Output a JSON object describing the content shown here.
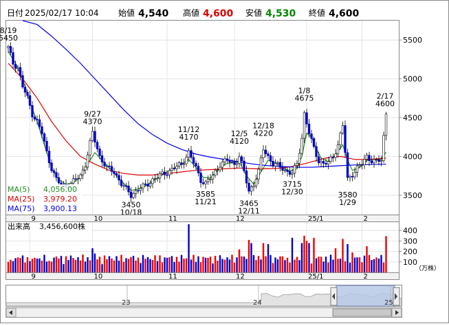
{
  "header": {
    "date_label": "日付",
    "date_value": "2025/02/17 10:04",
    "open_label": "始値",
    "open_value": "4,540",
    "high_label": "高値",
    "high_value": "4,600",
    "low_label": "安値",
    "low_value": "4,530",
    "close_label": "終値",
    "close_value": "4,600"
  },
  "colors": {
    "up": "#ffffff",
    "down": "#0000cc",
    "ma5": "#228b22",
    "ma25": "#dd0000",
    "ma75": "#0000ee",
    "vol_up": "#ee0000",
    "vol_down": "#0000cc",
    "high_text": "#e00000",
    "low_text": "#008800"
  },
  "legend": {
    "ma5": "MA(5)",
    "ma5_value": "4,056.00",
    "ma25": "MA(25)",
    "ma25_value": "3,979.20",
    "ma75": "MA(75)",
    "ma75_value": "3,900.13"
  },
  "volume_panel": {
    "label": "出来高",
    "value": "3,456,600株",
    "unit": "（万株）"
  },
  "navigator": {
    "year_labels": [
      "23",
      "24",
      "25"
    ]
  },
  "chart_data": [
    {
      "type": "candlestick",
      "ylim": [
        3250,
        5750
      ],
      "yticks": [
        3500,
        4000,
        4500,
        5000,
        5500
      ],
      "x_tick_labels": [
        {
          "label": "9",
          "day": 9
        },
        {
          "label": "10",
          "day": 35
        },
        {
          "label": "11",
          "day": 66
        },
        {
          "label": "12",
          "day": 94
        },
        {
          "label": "25/1",
          "day": 124
        },
        {
          "label": "2",
          "day": 147
        }
      ],
      "annotations": [
        {
          "text": [
            "8/19",
            "5450"
          ],
          "day": 0,
          "value": 5450,
          "pos": "above"
        },
        {
          "text": [
            "9/27",
            "4370"
          ],
          "day": 35,
          "value": 4370,
          "pos": "above"
        },
        {
          "text": [
            "3450",
            "10/18"
          ],
          "day": 51,
          "value": 3450,
          "pos": "below"
        },
        {
          "text": [
            "11/12",
            "4170"
          ],
          "day": 75,
          "value": 4170,
          "pos": "above"
        },
        {
          "text": [
            "3585",
            "11/21"
          ],
          "day": 82,
          "value": 3585,
          "pos": "below"
        },
        {
          "text": [
            "12/5",
            "4120"
          ],
          "day": 96,
          "value": 4120,
          "pos": "above"
        },
        {
          "text": [
            "3465",
            "12/11"
          ],
          "day": 100,
          "value": 3465,
          "pos": "below"
        },
        {
          "text": [
            "12/18",
            "4220"
          ],
          "day": 106,
          "value": 4220,
          "pos": "above"
        },
        {
          "text": [
            "3715",
            "12/30"
          ],
          "day": 118,
          "value": 3715,
          "pos": "below"
        },
        {
          "text": [
            "1/8",
            "4675"
          ],
          "day": 123,
          "value": 4675,
          "pos": "above"
        },
        {
          "text": [
            "3580",
            "1/29"
          ],
          "day": 141,
          "value": 3580,
          "pos": "below"
        },
        {
          "text": [
            "2/17",
            "4600"
          ],
          "day": 157,
          "value": 4600,
          "pos": "above"
        }
      ],
      "keypoints": [
        [
          0,
          5400
        ],
        [
          2,
          5200
        ],
        [
          4,
          5150
        ],
        [
          6,
          4900
        ],
        [
          8,
          4750
        ],
        [
          10,
          4550
        ],
        [
          12,
          4450
        ],
        [
          14,
          4300
        ],
        [
          16,
          4050
        ],
        [
          18,
          3850
        ],
        [
          20,
          3700
        ],
        [
          22,
          3630
        ],
        [
          24,
          3610
        ],
        [
          26,
          3650
        ],
        [
          28,
          3700
        ],
        [
          30,
          3750
        ],
        [
          32,
          3900
        ],
        [
          35,
          4300
        ],
        [
          38,
          4000
        ],
        [
          41,
          3850
        ],
        [
          44,
          3800
        ],
        [
          47,
          3650
        ],
        [
          51,
          3500
        ],
        [
          54,
          3580
        ],
        [
          57,
          3620
        ],
        [
          60,
          3700
        ],
        [
          63,
          3750
        ],
        [
          66,
          3800
        ],
        [
          69,
          3850
        ],
        [
          72,
          3900
        ],
        [
          75,
          4050
        ],
        [
          78,
          3850
        ],
        [
          80,
          3700
        ],
        [
          82,
          3650
        ],
        [
          85,
          3750
        ],
        [
          88,
          3900
        ],
        [
          91,
          3950
        ],
        [
          94,
          3900
        ],
        [
          96,
          4000
        ],
        [
          98,
          3800
        ],
        [
          100,
          3550
        ],
        [
          102,
          3650
        ],
        [
          104,
          3800
        ],
        [
          106,
          4100
        ],
        [
          108,
          4000
        ],
        [
          110,
          3900
        ],
        [
          112,
          3880
        ],
        [
          114,
          3850
        ],
        [
          116,
          3800
        ],
        [
          118,
          3780
        ],
        [
          120,
          3900
        ],
        [
          122,
          4250
        ],
        [
          123,
          4550
        ],
        [
          125,
          4300
        ],
        [
          127,
          4100
        ],
        [
          129,
          3950
        ],
        [
          131,
          3900
        ],
        [
          133,
          3920
        ],
        [
          135,
          4000
        ],
        [
          137,
          4150
        ],
        [
          139,
          4400
        ],
        [
          141,
          3700
        ],
        [
          143,
          3780
        ],
        [
          145,
          3850
        ],
        [
          147,
          3900
        ],
        [
          149,
          4000
        ],
        [
          151,
          3950
        ],
        [
          153,
          3930
        ],
        [
          155,
          3950
        ],
        [
          157,
          4560
        ]
      ],
      "moving_averages": [
        {
          "name": "MA(5)",
          "points": [
            [
              0,
              5350
            ],
            [
              3,
              5200
            ],
            [
              6,
              5000
            ],
            [
              9,
              4700
            ],
            [
              12,
              4450
            ],
            [
              15,
              4150
            ],
            [
              18,
              3850
            ],
            [
              21,
              3700
            ],
            [
              24,
              3640
            ],
            [
              27,
              3660
            ],
            [
              30,
              3730
            ],
            [
              33,
              3900
            ],
            [
              36,
              4050
            ],
            [
              39,
              3950
            ],
            [
              42,
              3850
            ],
            [
              45,
              3750
            ],
            [
              48,
              3650
            ],
            [
              51,
              3560
            ],
            [
              54,
              3580
            ],
            [
              57,
              3620
            ],
            [
              60,
              3680
            ],
            [
              63,
              3740
            ],
            [
              66,
              3800
            ],
            [
              69,
              3850
            ],
            [
              72,
              3900
            ],
            [
              75,
              3960
            ],
            [
              78,
              3860
            ],
            [
              81,
              3730
            ],
            [
              84,
              3720
            ],
            [
              87,
              3820
            ],
            [
              90,
              3900
            ],
            [
              93,
              3920
            ],
            [
              96,
              3930
            ],
            [
              99,
              3750
            ],
            [
              102,
              3640
            ],
            [
              105,
              3800
            ],
            [
              108,
              3950
            ],
            [
              111,
              3920
            ],
            [
              114,
              3860
            ],
            [
              117,
              3810
            ],
            [
              120,
              3840
            ],
            [
              122,
              4000
            ],
            [
              124,
              4300
            ],
            [
              126,
              4250
            ],
            [
              128,
              4100
            ],
            [
              130,
              3980
            ],
            [
              133,
              3930
            ],
            [
              136,
              4020
            ],
            [
              139,
              4150
            ],
            [
              141,
              3950
            ],
            [
              143,
              3820
            ],
            [
              145,
              3840
            ],
            [
              147,
              3880
            ],
            [
              149,
              3950
            ],
            [
              151,
              3960
            ],
            [
              153,
              3950
            ],
            [
              155,
              3960
            ],
            [
              157,
              4056
            ]
          ]
        },
        {
          "name": "MA(25)",
          "points": [
            [
              0,
              5200
            ],
            [
              6,
              5000
            ],
            [
              12,
              4750
            ],
            [
              18,
              4450
            ],
            [
              24,
              4200
            ],
            [
              30,
              4000
            ],
            [
              36,
              3900
            ],
            [
              42,
              3820
            ],
            [
              48,
              3780
            ],
            [
              54,
              3760
            ],
            [
              60,
              3760
            ],
            [
              66,
              3780
            ],
            [
              72,
              3800
            ],
            [
              78,
              3820
            ],
            [
              84,
              3830
            ],
            [
              90,
              3840
            ],
            [
              96,
              3850
            ],
            [
              102,
              3840
            ],
            [
              108,
              3840
            ],
            [
              114,
              3850
            ],
            [
              120,
              3880
            ],
            [
              126,
              3930
            ],
            [
              132,
              3980
            ],
            [
              138,
              4000
            ],
            [
              144,
              3960
            ],
            [
              150,
              3960
            ],
            [
              157,
              3979
            ]
          ]
        },
        {
          "name": "MA(75)",
          "points": [
            [
              6,
              5850
            ],
            [
              12,
              5700
            ],
            [
              18,
              5550
            ],
            [
              24,
              5380
            ],
            [
              30,
              5200
            ],
            [
              36,
              5000
            ],
            [
              42,
              4800
            ],
            [
              48,
              4600
            ],
            [
              54,
              4420
            ],
            [
              60,
              4280
            ],
            [
              66,
              4170
            ],
            [
              72,
              4090
            ],
            [
              78,
              4030
            ],
            [
              84,
              3990
            ],
            [
              90,
              3960
            ],
            [
              96,
              3930
            ],
            [
              102,
              3900
            ],
            [
              108,
              3880
            ],
            [
              114,
              3870
            ],
            [
              120,
              3860
            ],
            [
              126,
              3860
            ],
            [
              132,
              3870
            ],
            [
              138,
              3880
            ],
            [
              144,
              3890
            ],
            [
              150,
              3895
            ],
            [
              157,
              3900
            ]
          ]
        }
      ]
    },
    {
      "type": "bar",
      "title": "出来高",
      "ylim": [
        0,
        480
      ],
      "yticks": [
        100,
        200,
        300,
        400
      ],
      "spikes": [
        {
          "day": 1,
          "value": 120
        },
        {
          "day": 10,
          "value": 130
        },
        {
          "day": 17,
          "value": 110
        },
        {
          "day": 35,
          "value": 230
        },
        {
          "day": 36,
          "value": 180
        },
        {
          "day": 75,
          "value": 460
        },
        {
          "day": 82,
          "value": 140
        },
        {
          "day": 96,
          "value": 220
        },
        {
          "day": 100,
          "value": 310
        },
        {
          "day": 101,
          "value": 280
        },
        {
          "day": 106,
          "value": 280
        },
        {
          "day": 108,
          "value": 270
        },
        {
          "day": 118,
          "value": 330
        },
        {
          "day": 122,
          "value": 280
        },
        {
          "day": 123,
          "value": 350
        },
        {
          "day": 124,
          "value": 300
        },
        {
          "day": 125,
          "value": 280
        },
        {
          "day": 127,
          "value": 330
        },
        {
          "day": 136,
          "value": 230
        },
        {
          "day": 139,
          "value": 320
        },
        {
          "day": 141,
          "value": 270
        },
        {
          "day": 143,
          "value": 190
        },
        {
          "day": 149,
          "value": 250
        },
        {
          "day": 157,
          "value": 346
        }
      ]
    }
  ]
}
